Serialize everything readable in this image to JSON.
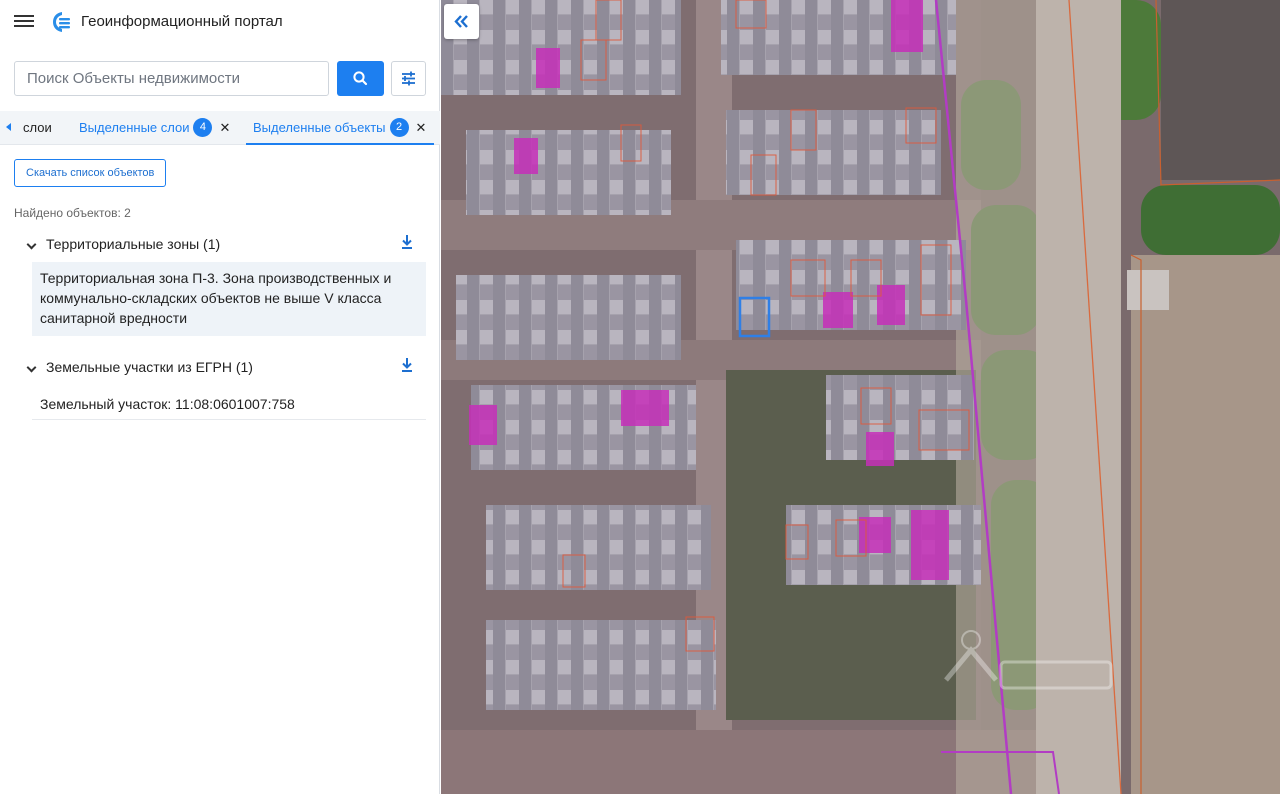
{
  "app": {
    "title": "Геоинформационный портал"
  },
  "search": {
    "placeholder": "Поиск Объекты недвижимости",
    "value": ""
  },
  "tabs": [
    {
      "label": "слои"
    },
    {
      "label": "Выделенные слои",
      "badge": "4"
    },
    {
      "label": "Выделенные объекты",
      "badge": "2",
      "active": true
    }
  ],
  "actions": {
    "download_list_label": "Скачать список объектов"
  },
  "results": {
    "found_label": "Найдено объектов: 2",
    "groups": [
      {
        "title": "Территориальные зоны (1)",
        "items": [
          "Территориальная зона П-3. Зона производственных и коммунально-складских объектов не выше V класса санитарной вредности"
        ]
      },
      {
        "title": "Земельные участки из ЕГРН (1)",
        "items": [
          "Земельный участок: 11:08:0601007:758"
        ]
      }
    ]
  },
  "icons": {
    "menu": "menu-icon",
    "logo": "portal-logo-icon",
    "search": "search-icon",
    "filter": "filter-sliders-icon",
    "download": "download-icon",
    "collapse": "double-chevron-left-icon"
  },
  "colors": {
    "accent": "#1d7ff0",
    "zone_boundary": "#b23cc4",
    "zone_fill": "#c62fb8",
    "parcel_outline": "#e0583a",
    "selected_parcel": "#2f7fe6"
  }
}
